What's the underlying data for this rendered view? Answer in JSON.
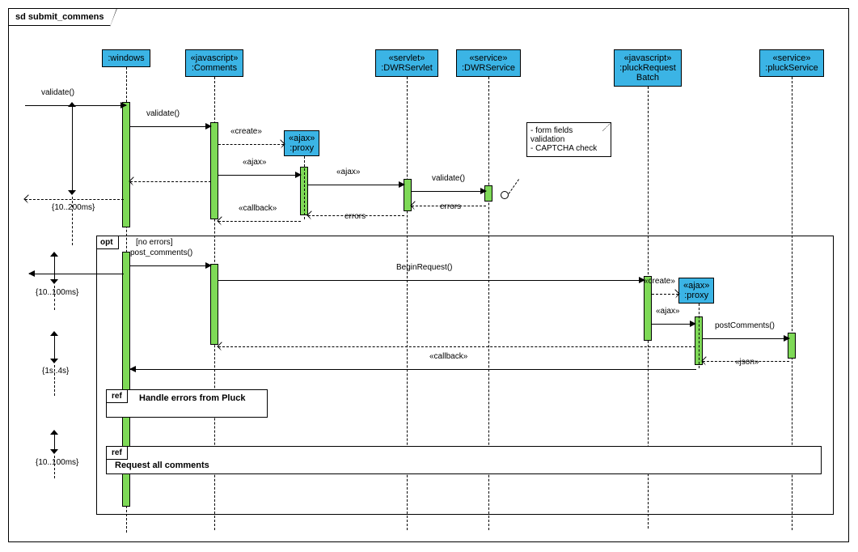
{
  "diagram_title_prefix": "sd",
  "diagram_title": "submit_commens",
  "lifelines": {
    "windows": {
      "name": ":windows",
      "stereotype": ""
    },
    "comments": {
      "name": ":Comments",
      "stereotype": "«javascript»"
    },
    "dwrservlet": {
      "name": ":DWRServlet",
      "stereotype": "«servlet»"
    },
    "dwrservice": {
      "name": ":DWRService",
      "stereotype": "«service»"
    },
    "pluckrequest": {
      "name": ":pluckRequest\nBatch",
      "stereotype": "«javascript»"
    },
    "pluckservice": {
      "name": ":pluckService",
      "stereotype": "«service»"
    }
  },
  "created": {
    "proxy1": {
      "name": ":proxy",
      "stereotype": "«ajax»"
    },
    "proxy2": {
      "name": ":proxy",
      "stereotype": "«ajax»"
    }
  },
  "messages": {
    "validate1": "validate()",
    "validate2": "validate()",
    "create1": "«create»",
    "ajax1": "«ajax»",
    "ajax2": "«ajax»",
    "validate3": "validate()",
    "errors1": "errors",
    "errors2": "errors",
    "callback1": "«callback»",
    "post_comments": "post_comments()",
    "begin_request": "BeginRequest()",
    "create2": "«create»",
    "ajax3": "«ajax»",
    "post_comments2": "postComments()",
    "json": "«json»",
    "callback2": "«callback»"
  },
  "frames": {
    "opt": "opt",
    "opt_guard": "[no errors]",
    "ref1": "ref",
    "ref1_text": "Handle errors from Pluck",
    "ref2": "ref",
    "ref2_text": "Request all comments"
  },
  "note": {
    "line1": "- form fields",
    "line2": "validation",
    "line3": "- CAPTCHA check"
  },
  "timings": {
    "t1": "{10..200ms}",
    "t2": "{10..100ms}",
    "t3": "{1s..4s}",
    "t4": "{10..100ms}"
  },
  "chart_data": {
    "type": "uml_sequence_diagram",
    "title": "sd submit_commens",
    "participants": [
      {
        "name": ":windows"
      },
      {
        "name": ":Comments",
        "stereotype": "javascript"
      },
      {
        "name": ":proxy",
        "stereotype": "ajax",
        "created": true
      },
      {
        "name": ":DWRServlet",
        "stereotype": "servlet"
      },
      {
        "name": ":DWRService",
        "stereotype": "service"
      },
      {
        "name": ":pluckRequestBatch",
        "stereotype": "javascript"
      },
      {
        "name": ":proxy",
        "stereotype": "ajax",
        "created": true
      },
      {
        "name": ":pluckService",
        "stereotype": "service"
      }
    ],
    "interactions": [
      {
        "from": "actor",
        "to": ":windows",
        "label": "validate()",
        "type": "sync"
      },
      {
        "from": ":windows",
        "to": ":Comments",
        "label": "validate()",
        "type": "sync"
      },
      {
        "from": ":Comments",
        "to": ":proxy1",
        "label": "«create»",
        "type": "create"
      },
      {
        "from": ":Comments",
        "to": ":proxy1",
        "label": "«ajax»",
        "type": "sync"
      },
      {
        "from": ":proxy1",
        "to": ":DWRServlet",
        "label": "«ajax»",
        "type": "sync"
      },
      {
        "from": ":DWRServlet",
        "to": ":DWRService",
        "label": "validate()",
        "type": "sync"
      },
      {
        "note_on": ":DWRService",
        "text": "- form fields validation - CAPTCHA check"
      },
      {
        "from": ":DWRService",
        "to": ":DWRServlet",
        "label": "errors",
        "type": "return"
      },
      {
        "from": ":DWRServlet",
        "to": ":proxy1",
        "label": "errors",
        "type": "return"
      },
      {
        "from": ":proxy1",
        "to": ":Comments",
        "label": "«callback»",
        "type": "return"
      },
      {
        "from": ":Comments",
        "to": ":windows",
        "label": "",
        "type": "return"
      },
      {
        "timing": "{10..200ms}"
      },
      {
        "fragment": "opt",
        "guard": "[no errors]",
        "contains": [
          {
            "from": ":windows",
            "to": ":Comments",
            "label": "post_comments()",
            "type": "sync"
          },
          {
            "from": ":windows",
            "to": "actor",
            "label": "",
            "type": "return"
          },
          {
            "timing": "{10..100ms}"
          },
          {
            "from": ":Comments",
            "to": ":pluckRequestBatch",
            "label": "BeginRequest()",
            "type": "sync"
          },
          {
            "from": ":pluckRequestBatch",
            "to": ":proxy2",
            "label": "«create»",
            "type": "create"
          },
          {
            "from": ":pluckRequestBatch",
            "to": ":proxy2",
            "label": "«ajax»",
            "type": "sync"
          },
          {
            "from": ":proxy2",
            "to": ":pluckService",
            "label": "postComments()",
            "type": "sync"
          },
          {
            "from": ":pluckService",
            "to": ":proxy2",
            "label": "«json»",
            "type": "return"
          },
          {
            "from": ":proxy2",
            "to": ":Comments",
            "label": "",
            "type": "return"
          },
          {
            "from": ":proxy2",
            "to": ":windows",
            "label": "«callback»",
            "type": "return"
          },
          {
            "timing": "{1s..4s}"
          },
          {
            "fragment": "ref",
            "text": "Handle errors from Pluck"
          },
          {
            "timing": "{10..100ms}"
          },
          {
            "fragment": "ref",
            "text": "Request all comments"
          }
        ]
      }
    ]
  }
}
